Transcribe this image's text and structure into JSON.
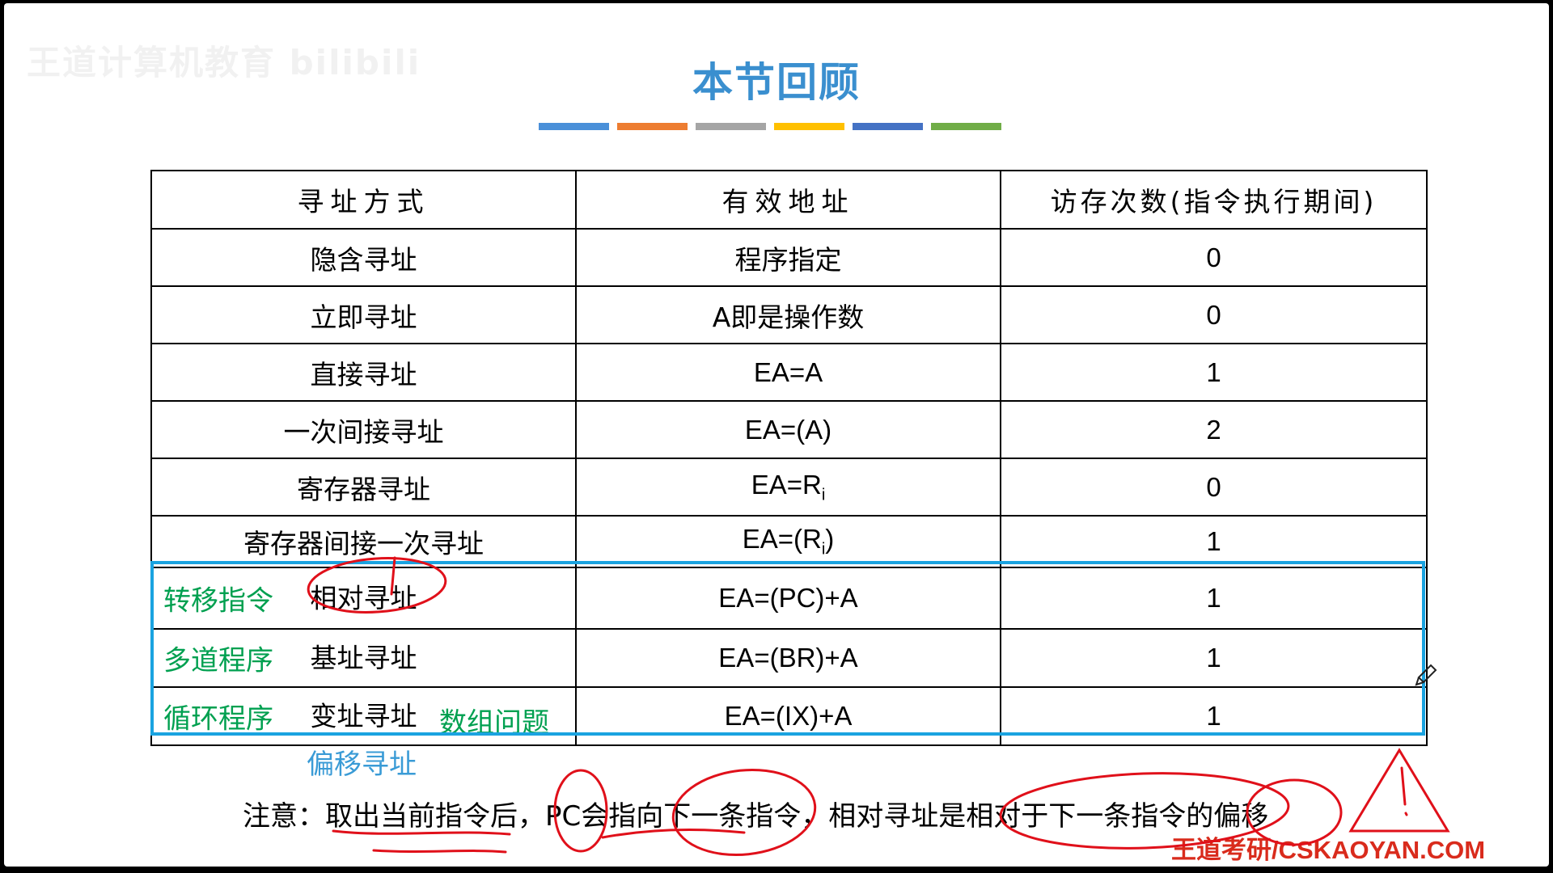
{
  "watermark": "王道计算机教育 bilibili",
  "title": "本节回顾",
  "title_bar_colors": [
    "#4a90d9",
    "#ed7d31",
    "#a5a5a5",
    "#ffc000",
    "#4472c4",
    "#70ad47"
  ],
  "table": {
    "headers": [
      "寻址方式",
      "有效地址",
      "访存次数(指令执行期间)"
    ],
    "rows": [
      {
        "mode": "隐含寻址",
        "ea": "程序指定",
        "count": "0"
      },
      {
        "mode": "立即寻址",
        "ea": "A即是操作数",
        "count": "0"
      },
      {
        "mode": "直接寻址",
        "ea": "EA=A",
        "count": "1"
      },
      {
        "mode": "一次间接寻址",
        "ea": "EA=(A)",
        "count": "2"
      },
      {
        "mode": "寄存器寻址",
        "ea_prefix": "EA=R",
        "ea_sub": "i",
        "ea_suffix": "",
        "count": "0"
      },
      {
        "mode": "寄存器间接一次寻址",
        "ea_prefix": "EA=(R",
        "ea_sub": "i",
        "ea_suffix": ")",
        "count": "1"
      },
      {
        "tag": "转移指令",
        "mode": "相对寻址",
        "ea": "EA=(PC)+A",
        "count": "1"
      },
      {
        "tag": "多道程序",
        "mode": "基址寻址",
        "ea": "EA=(BR)+A",
        "count": "1"
      },
      {
        "tag": "循环程序",
        "mode": "变址寻址",
        "extra": "数组问题",
        "ea": "EA=(IX)+A",
        "count": "1"
      }
    ]
  },
  "offset_label": "偏移寻址",
  "note": "注意：取出当前指令后，PC会指向下一条指令，相对寻址是相对于下一条指令的偏移",
  "brand": "王道考研/CSKAOYAN.COM",
  "colors": {
    "title": "#3a8fcf",
    "tag_green": "#00a050",
    "highlight_box": "#1aa3e0",
    "ink_red": "#e0101a",
    "offset_label": "#3a9bd6"
  },
  "icons": [
    "pencil-cursor-icon",
    "warning-triangle-icon"
  ]
}
